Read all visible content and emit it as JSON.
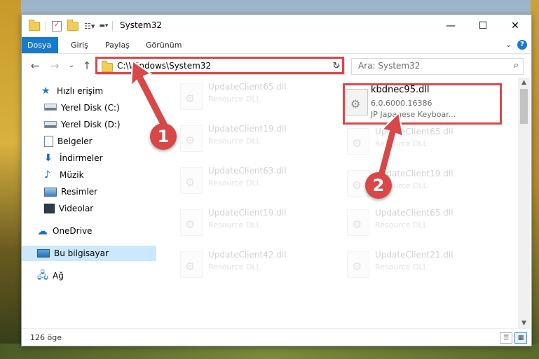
{
  "window": {
    "title": "System32",
    "minimize": "—",
    "maximize": "☐",
    "close": "✕"
  },
  "ribbon": {
    "tabs": [
      "Dosya",
      "Giriş",
      "Paylaş",
      "Görünüm"
    ],
    "help": "?",
    "expand": "⌄"
  },
  "address": {
    "back": "←",
    "forward": "→",
    "recent": "⌄",
    "up": "↑",
    "path": "C:\\Windows\\System32",
    "dropdown": "⌄",
    "refresh": "↻",
    "search_placeholder": "Ara: System32",
    "search_icon": "⌕"
  },
  "nav": {
    "items": [
      {
        "label": "Hızlı erişim",
        "icon": "star-icon",
        "pinned": false
      },
      {
        "label": "Yerel Disk (C:)",
        "icon": "drive-icon",
        "pinned": true
      },
      {
        "label": "Yerel Disk (D:)",
        "icon": "drive-icon",
        "pinned": true
      },
      {
        "label": "Belgeler",
        "icon": "documents-icon",
        "pinned": true
      },
      {
        "label": "İndirmeler",
        "icon": "download-icon",
        "pinned": true
      },
      {
        "label": "Müzik",
        "icon": "music-icon",
        "pinned": true
      },
      {
        "label": "Resimler",
        "icon": "pictures-icon",
        "pinned": true
      },
      {
        "label": "Videolar",
        "icon": "videos-icon",
        "pinned": true
      },
      {
        "label": "OneDrive",
        "icon": "cloud-icon",
        "pinned": false
      },
      {
        "label": "Bu bilgisayar",
        "icon": "computer-icon",
        "pinned": false
      },
      {
        "label": "Ağ",
        "icon": "network-icon",
        "pinned": false
      }
    ],
    "pin_glyph": "📌"
  },
  "files": {
    "left": [
      {
        "name": "UpdateClient65.dll",
        "type": "Resource DLL"
      },
      {
        "name": "UpdateClient19.dll",
        "type": "Resource DLL"
      },
      {
        "name": "UpdateClient63.dll",
        "type": "Resource DLL"
      },
      {
        "name": "UpdateClient19.dll",
        "type": "Resource DLL"
      },
      {
        "name": "UpdateClient42.dll",
        "type": "Resource DLL"
      }
    ],
    "right_main": {
      "name": "kbdnec95.dll",
      "version": "6.0.6000.16386",
      "desc": "JP Japanese Keyboar..."
    },
    "right": [
      {
        "name": "UpdateClient65.dll",
        "type": "Resource DLL"
      },
      {
        "name": "UpdateClient19.dll",
        "type": "Resource DLL"
      },
      {
        "name": "UpdateClient65.dll",
        "type": "Resource DLL"
      },
      {
        "name": "UpdateClient21.dll",
        "type": "Resource DLL"
      }
    ]
  },
  "status": {
    "count": "126 öge"
  },
  "annotations": {
    "step1": "1",
    "step2": "2",
    "color": "#d84848"
  }
}
